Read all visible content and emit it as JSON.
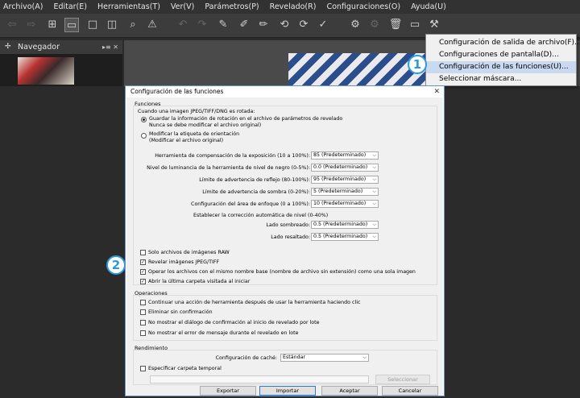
{
  "menubar": {
    "items": [
      "Archivo(A)",
      "Editar(E)",
      "Herramientas(T)",
      "Ver(V)",
      "Parámetros(P)",
      "Revelado(R)",
      "Configuraciones(O)",
      "Ayuda(U)"
    ]
  },
  "navigator": {
    "title": "Navegador",
    "controls": "▸≡ ✕"
  },
  "dropdown": {
    "items": [
      "Configuración de salida de archivo(F)...",
      "Configuraciones de pantalla(D)...",
      "Configuración de las funciones(U)...",
      "Seleccionar máscara..."
    ],
    "highlighted_index": 2
  },
  "callouts": {
    "one": "1",
    "two": "2"
  },
  "dialog": {
    "title": "Configuración de las funciones",
    "close": "✕",
    "funciones": {
      "title": "Funciones",
      "rotation_label": "Cuando una imagen JPEG/TIFF/DNG es rotada:",
      "radio1_line1": "Guardar la información de rotación en el archivo de parámetros de revelado",
      "radio1_line2": "Nunca se debe modificar el archivo original)",
      "radio2_line1": "Modificar la etiqueta de orientación",
      "radio2_line2": "(Modificar el archivo original)",
      "settings": [
        {
          "label": "Herramienta de compensación de la exposición (10 a 100%):",
          "value": "85 (Predeterminado)"
        },
        {
          "label": "Nivel de luminancia de la herramienta de nivel de negro (0-5%):",
          "value": "0.0 (Predeterminado)"
        },
        {
          "label": "Límite de advertencia de reflejo (80-100%):",
          "value": "95 (Predeterminado)"
        },
        {
          "label": "Límite de advertencia de sombra (0-20%):",
          "value": "5 (Predeterminado)"
        },
        {
          "label": "Configuración del área de enfoque (0 a 100%):",
          "value": "10 (Predeterminado)"
        }
      ],
      "auto_level_label": "Establecer la corrección automática de nivel (0-40%)",
      "shadow_label": "Lado sombreado:",
      "shadow_value": "0.5 (Predeterminado)",
      "highlight_label": "Lado resaltado:",
      "highlight_value": "0.5 (Predeterminado)",
      "checks": [
        {
          "label": "Solo archivos de imágenes RAW",
          "checked": false
        },
        {
          "label": "Revelar imágenes JPEG/TIFF",
          "checked": true
        },
        {
          "label": "Operar los archivos con el mismo nombre base (nombre de archivo sin extensión) como una sola imagen",
          "checked": true
        },
        {
          "label": "Abrir la última carpeta visitada al iniciar",
          "checked": true
        }
      ]
    },
    "operaciones": {
      "title": "Operaciones",
      "checks": [
        {
          "label": "Continuar una acción de herramienta después de usar la herramienta haciendo clic",
          "checked": false
        },
        {
          "label": "Eliminar sin confirmación",
          "checked": false
        },
        {
          "label": "No mostrar el diálogo de confirmación al inicio de revelado por lote",
          "checked": false
        },
        {
          "label": "No mostrar el error de mensaje durante el revelado en lote",
          "checked": false
        }
      ]
    },
    "rendimiento": {
      "title": "Rendimiento",
      "cache_label": "Configuración de caché:",
      "cache_value": "Estándar",
      "temp_label": "Especificar carpeta temporal",
      "select_button": "Seleccionar"
    },
    "buttons": {
      "export": "Exportar",
      "import": "Importar",
      "accept": "Aceptar",
      "cancel": "Cancelar"
    }
  },
  "toolbar": {
    "check_mark": "✓"
  }
}
